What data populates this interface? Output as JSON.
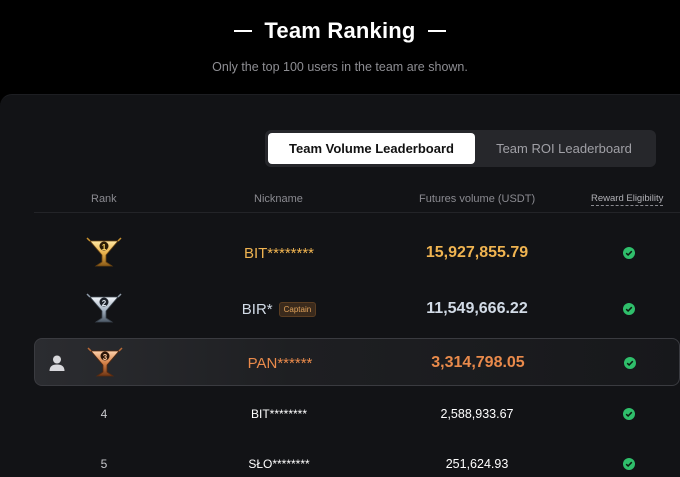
{
  "header": {
    "title": "Team Ranking",
    "subtitle": "Only the top 100 users in the team are shown."
  },
  "tabs": [
    {
      "label": "Team Volume Leaderboard",
      "active": true
    },
    {
      "label": "Team ROI Leaderboard",
      "active": false
    }
  ],
  "columns": {
    "rank": "Rank",
    "nickname": "Nickname",
    "volume": "Futures volume (USDT)",
    "reward": "Reward Eligibility"
  },
  "rows": [
    {
      "rank": "1",
      "medal": "gold-trophy-icon",
      "nickname": "BIT********",
      "badge": "",
      "volume": "15,927,855.79",
      "eligible": true,
      "current_user": false
    },
    {
      "rank": "2",
      "medal": "silver-trophy-icon",
      "nickname": "BIR*",
      "badge": "Captain",
      "volume": "11,549,666.22",
      "eligible": true,
      "current_user": false
    },
    {
      "rank": "3",
      "medal": "bronze-trophy-icon",
      "nickname": "PAN******",
      "badge": "",
      "volume": "3,314,798.05",
      "eligible": true,
      "current_user": true
    },
    {
      "rank": "4",
      "medal": "",
      "nickname": "BIT********",
      "badge": "",
      "volume": "2,588,933.67",
      "eligible": true,
      "current_user": false
    },
    {
      "rank": "5",
      "medal": "",
      "nickname": "SŁO********",
      "badge": "",
      "volume": "251,624.93",
      "eligible": true,
      "current_user": false
    }
  ],
  "colors": {
    "gold": "#f0b451",
    "silver": "#d2dbe6",
    "bronze": "#e98a4b",
    "check": "#2fbf6b",
    "background": "#000000",
    "panel": "#121316"
  }
}
